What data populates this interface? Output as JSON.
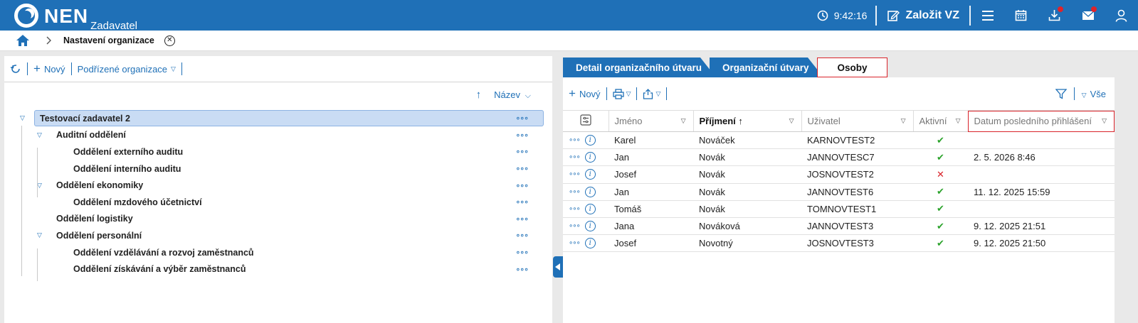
{
  "app": {
    "logo_text": "NEN",
    "logo_sub": "Zadavatel",
    "time": "9:42:16",
    "create_label": "Založit VZ"
  },
  "breadcrumb": {
    "title": "Nastavení organizace"
  },
  "left": {
    "toolbar": {
      "new_label": "Nový",
      "sub_label": "Podřízené organizace"
    },
    "sort_label": "Název",
    "tree": [
      {
        "label": "Testovací zadavatel 2",
        "level": 0,
        "expand": true,
        "selected": true
      },
      {
        "label": "Auditní oddělení",
        "level": 1,
        "expand": true
      },
      {
        "label": "Oddělení externího auditu",
        "level": 2
      },
      {
        "label": "Oddělení interního auditu",
        "level": 2
      },
      {
        "label": "Oddělení ekonomiky",
        "level": 1,
        "expand": true
      },
      {
        "label": "Oddělení mzdového účetnictví",
        "level": 2
      },
      {
        "label": "Oddělení logistiky",
        "level": 1
      },
      {
        "label": "Oddělení personální",
        "level": 1,
        "expand": true
      },
      {
        "label": "Oddělení vzdělávání a rozvoj zaměstnanců",
        "level": 2
      },
      {
        "label": "Oddělení získávání a výběr zaměstnanců",
        "level": 2
      }
    ]
  },
  "right": {
    "tabs": [
      "Detail organizačního útvaru",
      "Organizační útvary",
      "Osoby"
    ],
    "toolbar": {
      "new_label": "Nový",
      "filter_label": "Vše"
    },
    "columns": [
      "Jméno",
      "Příjmení",
      "Uživatel",
      "Aktivní",
      "Datum posledního přihlášení"
    ],
    "rows": [
      {
        "first": "Karel",
        "last": "Nováček",
        "user": "KARNOVTEST2",
        "active": true,
        "date": ""
      },
      {
        "first": "Jan",
        "last": "Novák",
        "user": "JANNOVTESC7",
        "active": true,
        "date": "2. 5. 2026 8:46"
      },
      {
        "first": "Josef",
        "last": "Novák",
        "user": "JOSNOVTEST2",
        "active": false,
        "date": ""
      },
      {
        "first": "Jan",
        "last": "Novák",
        "user": "JANNOVTEST6",
        "active": true,
        "date": "11. 12. 2025 15:59"
      },
      {
        "first": "Tomáš",
        "last": "Novák",
        "user": "TOMNOVTEST1",
        "active": true,
        "date": ""
      },
      {
        "first": "Jana",
        "last": "Nováková",
        "user": "JANNOVTEST3",
        "active": true,
        "date": "9. 12. 2025 21:51"
      },
      {
        "first": "Josef",
        "last": "Novotný",
        "user": "JOSNOVTEST3",
        "active": true,
        "date": "9. 12. 2025 21:50"
      }
    ]
  }
}
